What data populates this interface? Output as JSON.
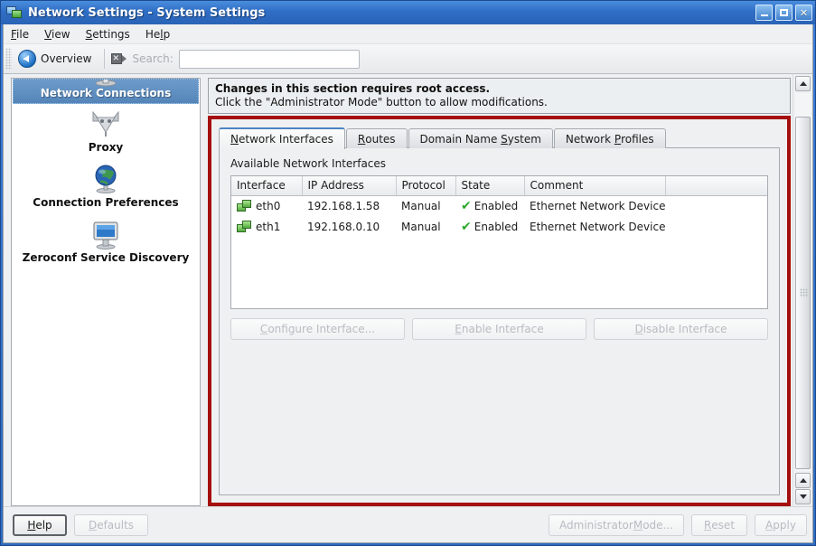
{
  "window": {
    "title": "Network Settings - System Settings",
    "title_icon": "monitor-network-icon",
    "minimize_label": "_",
    "maximize_label": "□",
    "close_label": "✕"
  },
  "menubar": {
    "items": [
      {
        "label": "File",
        "mnemonic": "F"
      },
      {
        "label": "View",
        "mnemonic": "V"
      },
      {
        "label": "Settings",
        "mnemonic": "S"
      },
      {
        "label": "Help",
        "mnemonic": "H"
      }
    ]
  },
  "toolbar": {
    "overview_label": "Overview",
    "back_icon": "back-arrow-icon",
    "clear_icon": "clear-search-icon",
    "search_label": "Search:",
    "search_value": "",
    "search_placeholder": ""
  },
  "sidebar": {
    "items": [
      {
        "label": "Network Connections",
        "icon": "network-connections-icon",
        "selected": true
      },
      {
        "label": "Proxy",
        "icon": "proxy-icon",
        "selected": false
      },
      {
        "label": "Connection Preferences",
        "icon": "globe-icon",
        "selected": false
      },
      {
        "label": "Zeroconf Service Discovery",
        "icon": "monitor-icon",
        "selected": false
      }
    ]
  },
  "notice": {
    "line1": "Changes in this section requires root access.",
    "line2": "Click the \"Administrator Mode\" button to allow modifications."
  },
  "tabs": [
    {
      "label": "Network Interfaces",
      "mnemonic": "N",
      "active": true
    },
    {
      "label": "Routes",
      "mnemonic": "R",
      "active": false
    },
    {
      "label": "Domain Name System",
      "mnemonic": "S",
      "active": false
    },
    {
      "label": "Network Profiles",
      "mnemonic": "P",
      "active": false
    }
  ],
  "interfaces_panel": {
    "caption": "Available Network Interfaces",
    "columns": [
      "Interface",
      "IP Address",
      "Protocol",
      "State",
      "Comment",
      ""
    ],
    "rows": [
      {
        "interface": "eth0",
        "icon": "network-card-icon",
        "ip_address": "192.168.1.58",
        "protocol": "Manual",
        "state": "Enabled",
        "state_icon": "green-check-icon",
        "comment": "Ethernet Network Device"
      },
      {
        "interface": "eth1",
        "icon": "network-card-icon",
        "ip_address": "192.168.0.10",
        "protocol": "Manual",
        "state": "Enabled",
        "state_icon": "green-check-icon",
        "comment": "Ethernet Network Device"
      }
    ],
    "buttons": [
      {
        "label": "Configure Interface...",
        "mnemonic": "C",
        "enabled": false
      },
      {
        "label": "Enable Interface",
        "mnemonic": "E",
        "enabled": false
      },
      {
        "label": "Disable Interface",
        "mnemonic": "D",
        "enabled": false
      }
    ]
  },
  "bottombar": {
    "help": {
      "label": "Help",
      "mnemonic": "H",
      "enabled": true,
      "default": true
    },
    "defaults": {
      "label": "Defaults",
      "mnemonic": "D",
      "enabled": false
    },
    "admin_mode": {
      "label": "Administrator Mode...",
      "mnemonic": "M",
      "enabled": false
    },
    "reset": {
      "label": "Reset",
      "mnemonic": "R",
      "enabled": false
    },
    "apply": {
      "label": "Apply",
      "mnemonic": "A",
      "enabled": false
    }
  },
  "colors": {
    "highlight_frame": "#a50f0f",
    "title_bar": "#2f6ec5",
    "selection": "#5585b8",
    "status_ok": "#2ea82e"
  }
}
